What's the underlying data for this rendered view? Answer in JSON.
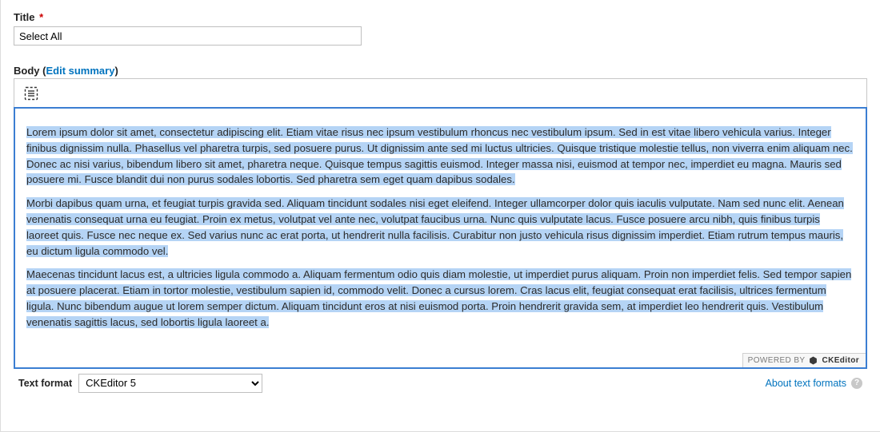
{
  "title_field": {
    "label": "Title",
    "required_marker": "*",
    "value": "Select All"
  },
  "body_field": {
    "label": "Body",
    "edit_summary_link": "Edit summary",
    "paragraphs": [
      "Lorem ipsum dolor sit amet, consectetur adipiscing elit. Etiam vitae risus nec ipsum vestibulum rhoncus nec vestibulum ipsum. Sed in est vitae libero vehicula varius. Integer finibus dignissim nulla. Phasellus vel pharetra turpis, sed posuere purus. Ut dignissim ante sed mi luctus ultricies. Quisque tristique molestie tellus, non viverra enim aliquam nec. Donec ac nisi varius, bibendum libero sit amet, pharetra neque. Quisque tempus sagittis euismod. Integer massa nisi, euismod at tempor nec, imperdiet eu magna. Mauris sed posuere mi. Fusce blandit dui non purus sodales lobortis. Sed pharetra sem eget quam dapibus sodales.",
      "Morbi dapibus quam urna, et feugiat turpis gravida sed. Aliquam tincidunt sodales nisi eget eleifend. Integer ullamcorper dolor quis iaculis vulputate. Nam sed nunc elit. Aenean venenatis consequat urna eu feugiat. Proin ex metus, volutpat vel ante nec, volutpat faucibus urna. Nunc quis vulputate lacus. Fusce posuere arcu nibh, quis finibus turpis laoreet quis. Fusce nec neque ex. Sed varius nunc ac erat porta, ut hendrerit nulla facilisis. Curabitur non justo vehicula risus dignissim imperdiet. Etiam rutrum tempus mauris, eu dictum ligula commodo vel.",
      "Maecenas tincidunt lacus est, a ultricies ligula commodo a. Aliquam fermentum odio quis diam molestie, ut imperdiet purus aliquam. Proin non imperdiet felis. Sed tempor sapien at posuere placerat. Etiam in tortor molestie, vestibulum sapien id, commodo velit. Donec a cursus lorem. Cras lacus elit, feugiat consequat erat facilisis, ultrices fermentum ligula. Nunc bibendum augue ut lorem semper dictum. Aliquam tincidunt eros at nisi euismod porta. Proin hendrerit gravida sem, at imperdiet leo hendrerit quis. Vestibulum venenatis sagittis lacus, sed lobortis ligula laoreet a."
    ],
    "powered_by": "POWERED BY",
    "ck_brand": "CKEditor"
  },
  "text_format": {
    "label": "Text format",
    "selected": "CKEditor 5",
    "about_link": "About text formats"
  }
}
